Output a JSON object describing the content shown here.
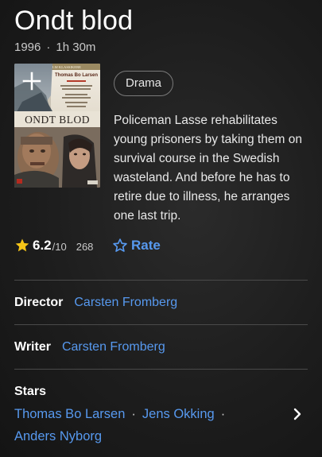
{
  "movie": {
    "title": "Ondt blod",
    "year": "1996",
    "separator": "·",
    "runtime": "1h 30m",
    "genre": "Drama",
    "description": "Policeman Lasse rehabilitates young prisoners by taking them on survival course in the Swedish wasteland. And before he has to retire due to illness, he arranges one last trip."
  },
  "poster": {
    "top_band_text": "DANSKE FILM KLASSIKERE",
    "actor_text": "Thomas Bo Larsen",
    "title_text": "ONDT BLOD",
    "icon": "add-icon"
  },
  "rating": {
    "score": "6.2",
    "out_of": "/10",
    "votes": "268",
    "rate_label": "Rate",
    "star_color": "#f5c518",
    "accent_color": "#5799ef"
  },
  "credits": {
    "director_label": "Director",
    "director": "Carsten Fromberg",
    "writer_label": "Writer",
    "writer": "Carsten Fromberg",
    "stars_label": "Stars",
    "stars": [
      "Thomas Bo Larsen",
      "Jens Okking",
      "Anders Nyborg"
    ],
    "stars_separator": "·"
  }
}
